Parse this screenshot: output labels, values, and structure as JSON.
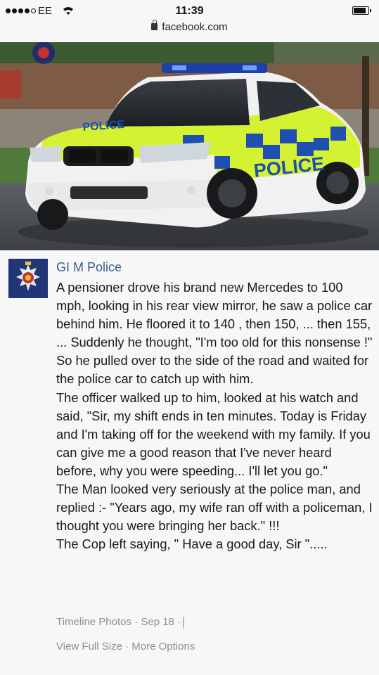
{
  "status_bar": {
    "carrier": "EE",
    "time": "11:39",
    "url": "facebook.com"
  },
  "photo": {
    "car_text_side": "POLICE",
    "car_text_bonnet": "POLICE"
  },
  "post": {
    "author": "GI M Police",
    "paragraphs": [
      "A pensioner drove his brand new Mercedes to 100 mph, looking in his rear view mirror, he saw a police car behind him. He floored it to 140 , then 150, ... then 155, ... Suddenly he thought, \"I'm too old for this nonsense !\" So he pulled over to the side of the road and waited for the police car to catch up with him.",
      "The officer walked up to him, looked at his watch and said, \"Sir, my shift ends in ten minutes. Today is Friday and I'm taking off for the weekend with my family. If you can give me a good reason that I've never heard before, why you were speeding... I'll let you go.\"",
      "The Man looked very seriously at the police man, and replied :- \"Years ago, my wife ran off with a policeman, I thought you were bringing her back.\" !!!",
      "The Cop left saying, \" Have a good day, Sir \"....."
    ],
    "meta": {
      "album": "Timeline Photos",
      "sep1": " · ",
      "date": "Sep 18",
      "sep2": " · "
    },
    "actions": {
      "view_full_size": "View Full Size",
      "sep": " · ",
      "more_options": "More Options"
    }
  },
  "colors": {
    "author_link": "#3b5b8e",
    "meta_gray": "#8a8f98",
    "police_yellow": "#d4f231",
    "police_blue": "#1f4fb0"
  }
}
